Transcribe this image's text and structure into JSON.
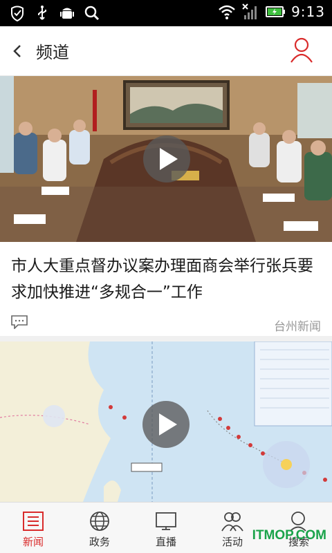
{
  "status_bar": {
    "time": "9:13"
  },
  "header": {
    "title": "频道",
    "back_icon": "chevron-left-icon",
    "user_icon": "user-icon"
  },
  "feed": [
    {
      "headline": "市人大重点督办议案办理面商会举行张兵要求加快推进“多规合一”工作",
      "source": "台州新闻",
      "has_video": true
    },
    {
      "has_video": true
    }
  ],
  "bottom_nav": [
    {
      "label": "新闻",
      "icon": "news-icon",
      "active": true
    },
    {
      "label": "政务",
      "icon": "globe-icon",
      "active": false
    },
    {
      "label": "直播",
      "icon": "tv-icon",
      "active": false
    },
    {
      "label": "活动",
      "icon": "people-icon",
      "active": false
    },
    {
      "label": "搜索",
      "icon": "search-icon",
      "active": false
    }
  ],
  "watermark": "ITMOP.COM",
  "colors": {
    "accent": "#d92b2b",
    "statusbar": "#000000",
    "watermark": "#1aa34a"
  }
}
